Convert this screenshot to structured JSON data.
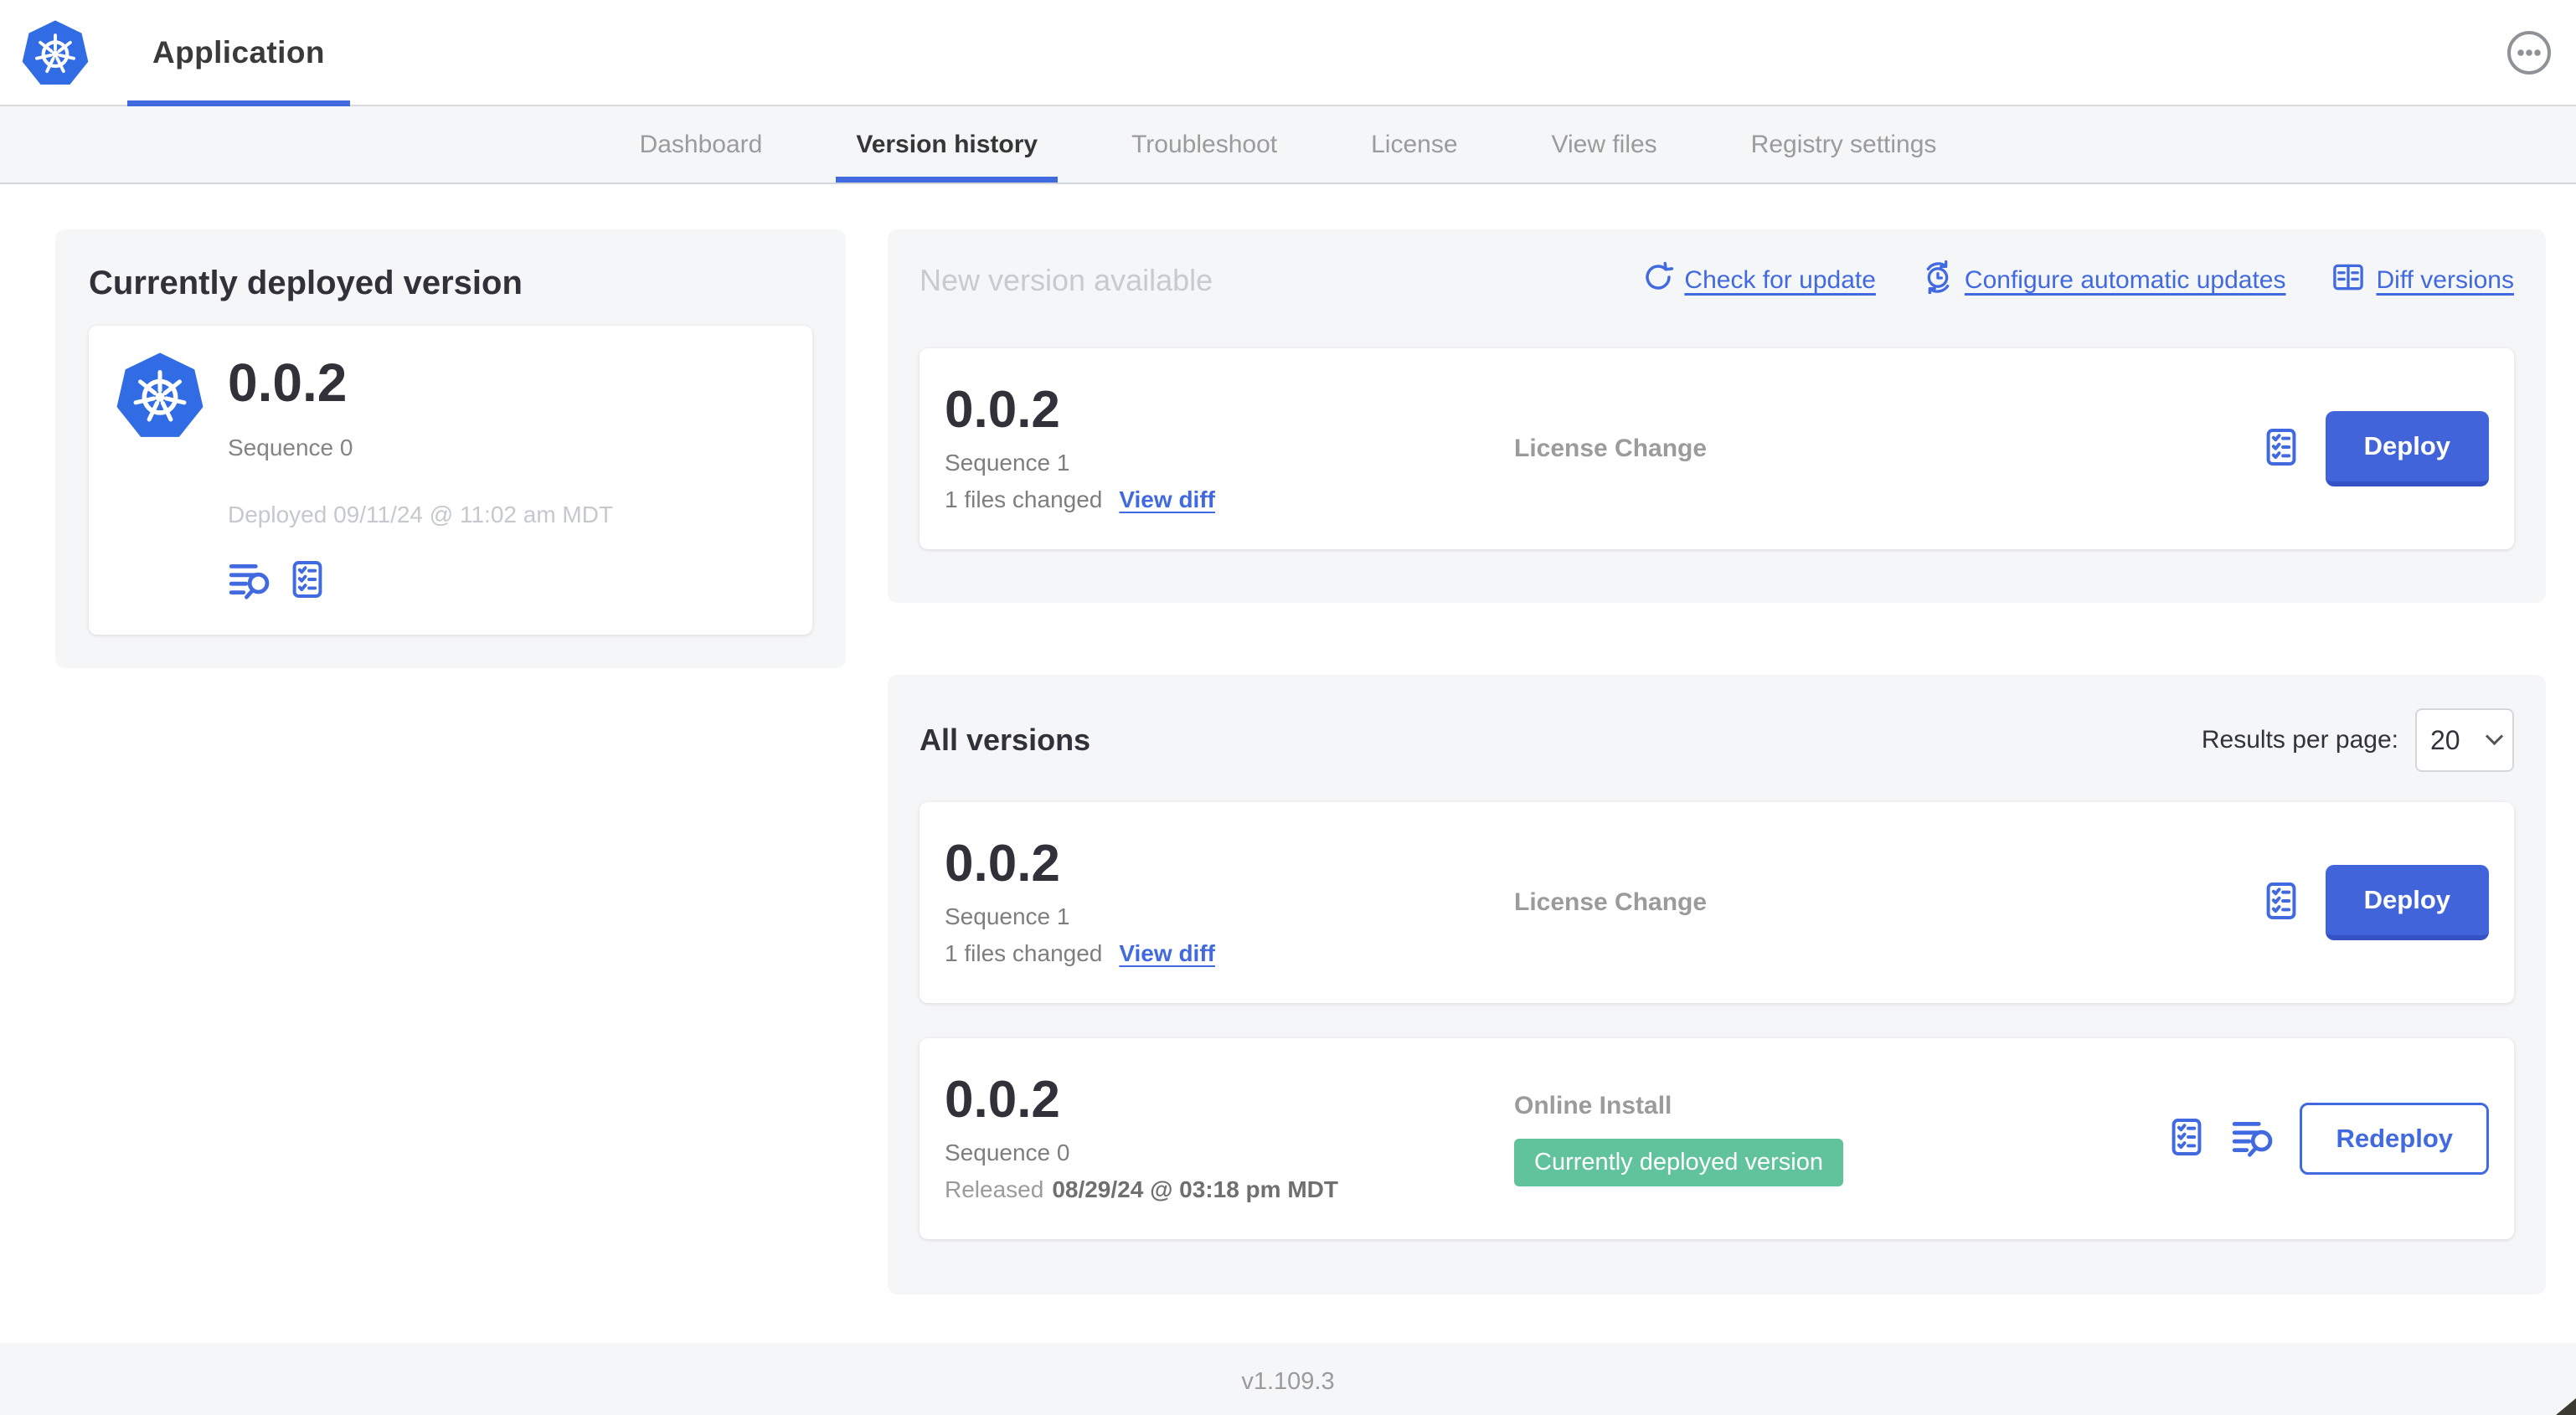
{
  "header": {
    "title": "Application"
  },
  "nav": {
    "tabs": [
      {
        "label": "Dashboard"
      },
      {
        "label": "Version history",
        "active": true
      },
      {
        "label": "Troubleshoot"
      },
      {
        "label": "License"
      },
      {
        "label": "View files"
      },
      {
        "label": "Registry settings"
      }
    ]
  },
  "current_version": {
    "heading": "Currently deployed version",
    "version": "0.0.2",
    "sequence": "Sequence 0",
    "deployed": "Deployed 09/11/24 @ 11:02 am MDT"
  },
  "new_version": {
    "heading": "New version available",
    "links": {
      "check_for_update": "Check for update",
      "configure_auto_updates": "Configure automatic updates",
      "diff_versions": "Diff versions"
    },
    "card": {
      "version": "0.0.2",
      "sequence": "Sequence 1",
      "files_changed": "1 files changed",
      "view_diff": "View diff",
      "source": "License Change",
      "deploy": "Deploy"
    }
  },
  "all_versions": {
    "heading": "All versions",
    "results_per_page_label": "Results per page:",
    "results_per_page": "20",
    "rows": [
      {
        "version": "0.0.2",
        "sequence": "Sequence 1",
        "files_changed": "1 files changed",
        "view_diff": "View diff",
        "source": "License Change",
        "action": "Deploy"
      },
      {
        "version": "0.0.2",
        "sequence": "Sequence 0",
        "released_prefix": "Released",
        "released_date": "08/29/24 @ 03:18 pm MDT",
        "source": "Online Install",
        "badge": "Currently deployed version",
        "action": "Redeploy"
      }
    ]
  },
  "footer": {
    "app_version": "v1.109.3"
  },
  "colors": {
    "accent_blue": "#4169e0",
    "button_blue": "#4264da",
    "k8s_blue": "#326ce5",
    "badge_green": "#61c39b",
    "panel_gray": "#f5f6f8"
  }
}
